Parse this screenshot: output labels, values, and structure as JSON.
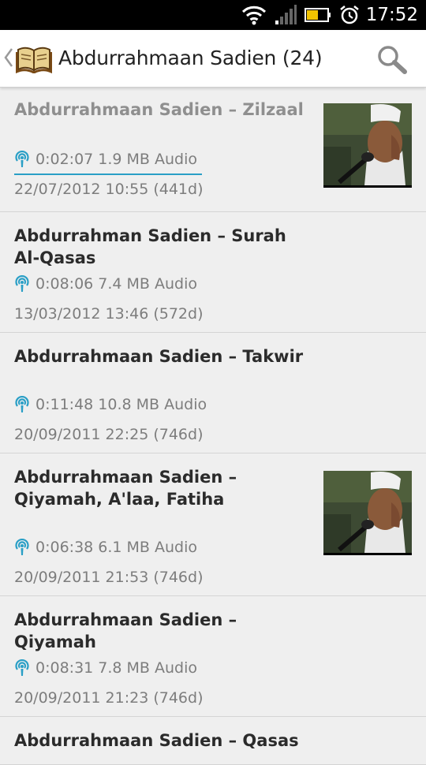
{
  "status_bar": {
    "time": "17:52",
    "icons": [
      "wifi-icon",
      "signal-icon",
      "battery-icon",
      "alarm-icon"
    ]
  },
  "action_bar": {
    "title": "Abdurrahmaan Sadien (24)",
    "icons": [
      "back-chevron-icon",
      "quran-book-icon",
      "search-icon"
    ]
  },
  "episodes": [
    {
      "title": "Abdurrahmaan Sadien – Zilzaal",
      "meta": "0:02:07 1.9 MB Audio",
      "date": "22/07/2012 10:55 (441d)",
      "played": true,
      "progress": 1.0,
      "has_thumbnail": true
    },
    {
      "title": "Abdurrahman Sadien – Surah Al-Qasas",
      "meta": "0:08:06 7.4 MB Audio",
      "date": "13/03/2012 13:46 (572d)",
      "played": false,
      "has_thumbnail": false
    },
    {
      "title": "Abdurrahmaan Sadien – Takwir",
      "meta": "0:11:48 10.8 MB Audio",
      "date": "20/09/2011 22:25 (746d)",
      "played": false,
      "has_thumbnail": false
    },
    {
      "title": "Abdurrahmaan Sadien – Qiyamah, A'laa, Fatiha",
      "meta": "0:06:38 6.1 MB Audio",
      "date": "20/09/2011 21:53 (746d)",
      "played": false,
      "has_thumbnail": true
    },
    {
      "title": "Abdurrahmaan Sadien – Qiyamah",
      "meta": "0:08:31 7.8 MB Audio",
      "date": "20/09/2011 21:23 (746d)",
      "played": false,
      "has_thumbnail": false
    },
    {
      "title": "Abdurrahmaan Sadien – Qasas",
      "meta": "",
      "date": "",
      "played": false,
      "has_thumbnail": false
    }
  ],
  "colors": {
    "accent": "#2a9fc6",
    "background": "#efefef",
    "text": "#2b2b2b",
    "secondary_text": "#7d7d7d"
  }
}
